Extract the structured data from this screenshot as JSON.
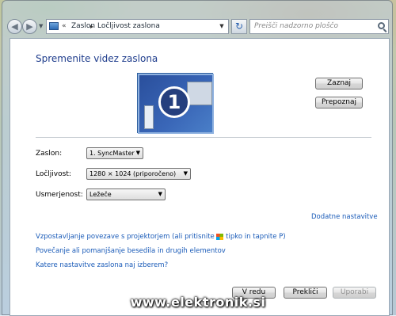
{
  "addressbar": {
    "overflow": "«",
    "crumbs": [
      "Zaslon",
      "Ločljivost zaslona"
    ],
    "separator": "▸",
    "refresh": "↻",
    "search_placeholder": "Preišči nadzorno ploščo"
  },
  "page": {
    "title": "Spremenite videz zaslona",
    "monitor_number": "1"
  },
  "buttons": {
    "detect": "Zaznaj",
    "identify": "Prepoznaj",
    "ok": "V redu",
    "cancel": "Prekliči",
    "apply": "Uporabi"
  },
  "settings": {
    "display_label": "Zaslon:",
    "display_value": "1. SyncMaster",
    "resolution_label": "Ločljivost:",
    "resolution_value": "1280 × 1024 (priporočeno)",
    "orientation_label": "Usmerjenost:",
    "orientation_value": "Ležeče"
  },
  "links": {
    "advanced": "Dodatne nastavitve",
    "projector_before": "Vzpostavljanje povezave s projektorjem (ali pritisnite ",
    "projector_after": " tipko in tapnite P)",
    "text_size": "Povečanje ali pomanjšanje besedila in drugih elementov",
    "which_settings": "Katere nastavitve zaslona naj izberem?"
  },
  "icons": {
    "back": "back-arrow-icon",
    "forward": "forward-arrow-icon",
    "search": "search-icon",
    "windows": "windows-logo-icon"
  },
  "watermark": "www.elektronik.si"
}
